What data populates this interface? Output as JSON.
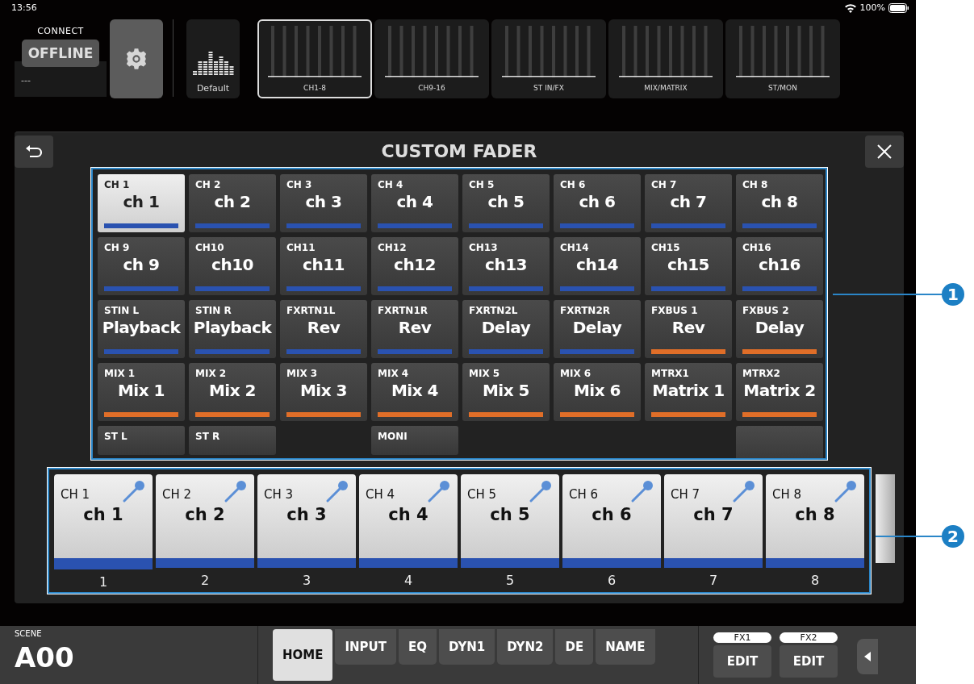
{
  "status_bar": {
    "time": "13:56",
    "battery": "100%"
  },
  "connect": {
    "label": "CONNECT",
    "status": "OFFLINE",
    "device": "---"
  },
  "library": {
    "label": "Default"
  },
  "bank_tabs": [
    {
      "label": "CH1-8",
      "selected": true
    },
    {
      "label": "CH9-16",
      "selected": false
    },
    {
      "label": "ST IN/FX",
      "selected": false
    },
    {
      "label": "MIX/MATRIX",
      "selected": false
    },
    {
      "label": "ST/MON",
      "selected": false
    }
  ],
  "dialog": {
    "title": "CUSTOM FADER"
  },
  "channel_grid": [
    {
      "kind": "full",
      "label": "CH 1",
      "name": "ch 1",
      "color": "#2a52b0",
      "selected": true
    },
    {
      "kind": "full",
      "label": "CH 2",
      "name": "ch 2",
      "color": "#2a52b0",
      "selected": false
    },
    {
      "kind": "full",
      "label": "CH 3",
      "name": "ch 3",
      "color": "#2a52b0",
      "selected": false
    },
    {
      "kind": "full",
      "label": "CH 4",
      "name": "ch 4",
      "color": "#2a52b0",
      "selected": false
    },
    {
      "kind": "full",
      "label": "CH 5",
      "name": "ch 5",
      "color": "#2a52b0",
      "selected": false
    },
    {
      "kind": "full",
      "label": "CH 6",
      "name": "ch 6",
      "color": "#2a52b0",
      "selected": false
    },
    {
      "kind": "full",
      "label": "CH 7",
      "name": "ch 7",
      "color": "#2a52b0",
      "selected": false
    },
    {
      "kind": "full",
      "label": "CH 8",
      "name": "ch 8",
      "color": "#2a52b0",
      "selected": false
    },
    {
      "kind": "full",
      "label": "CH 9",
      "name": "ch 9",
      "color": "#2a52b0",
      "selected": false
    },
    {
      "kind": "full",
      "label": "CH10",
      "name": "ch10",
      "color": "#2a52b0",
      "selected": false
    },
    {
      "kind": "full",
      "label": "CH11",
      "name": "ch11",
      "color": "#2a52b0",
      "selected": false
    },
    {
      "kind": "full",
      "label": "CH12",
      "name": "ch12",
      "color": "#2a52b0",
      "selected": false
    },
    {
      "kind": "full",
      "label": "CH13",
      "name": "ch13",
      "color": "#2a52b0",
      "selected": false
    },
    {
      "kind": "full",
      "label": "CH14",
      "name": "ch14",
      "color": "#2a52b0",
      "selected": false
    },
    {
      "kind": "full",
      "label": "CH15",
      "name": "ch15",
      "color": "#2a52b0",
      "selected": false
    },
    {
      "kind": "full",
      "label": "CH16",
      "name": "ch16",
      "color": "#2a52b0",
      "selected": false
    },
    {
      "kind": "full",
      "label": "STIN L",
      "name": "Playback",
      "color": "#2a52b0",
      "selected": false
    },
    {
      "kind": "full",
      "label": "STIN R",
      "name": "Playback",
      "color": "#2a52b0",
      "selected": false
    },
    {
      "kind": "full",
      "label": "FXRTN1L",
      "name": "Rev",
      "color": "#2a52b0",
      "selected": false
    },
    {
      "kind": "full",
      "label": "FXRTN1R",
      "name": "Rev",
      "color": "#2a52b0",
      "selected": false
    },
    {
      "kind": "full",
      "label": "FXRTN2L",
      "name": "Delay",
      "color": "#2a52b0",
      "selected": false
    },
    {
      "kind": "full",
      "label": "FXRTN2R",
      "name": "Delay",
      "color": "#2a52b0",
      "selected": false
    },
    {
      "kind": "full",
      "label": "FXBUS 1",
      "name": "Rev",
      "color": "#e06e28",
      "selected": false
    },
    {
      "kind": "full",
      "label": "FXBUS 2",
      "name": "Delay",
      "color": "#e06e28",
      "selected": false
    },
    {
      "kind": "full",
      "label": "MIX 1",
      "name": "Mix 1",
      "color": "#e06e28",
      "selected": false
    },
    {
      "kind": "full",
      "label": "MIX 2",
      "name": "Mix 2",
      "color": "#e06e28",
      "selected": false
    },
    {
      "kind": "full",
      "label": "MIX 3",
      "name": "Mix 3",
      "color": "#e06e28",
      "selected": false
    },
    {
      "kind": "full",
      "label": "MIX 4",
      "name": "Mix 4",
      "color": "#e06e28",
      "selected": false
    },
    {
      "kind": "full",
      "label": "MIX 5",
      "name": "Mix 5",
      "color": "#e06e28",
      "selected": false
    },
    {
      "kind": "full",
      "label": "MIX 6",
      "name": "Mix 6",
      "color": "#e06e28",
      "selected": false
    },
    {
      "kind": "full",
      "label": "MTRX1",
      "name": "Matrix 1",
      "color": "#e06e28",
      "selected": false
    },
    {
      "kind": "full",
      "label": "MTRX2",
      "name": "Matrix 2",
      "color": "#e06e28",
      "selected": false
    },
    {
      "kind": "partial",
      "label": "ST L"
    },
    {
      "kind": "partial",
      "label": "ST R"
    },
    {
      "kind": "empty"
    },
    {
      "kind": "partial",
      "label": "MONI"
    },
    {
      "kind": "empty"
    },
    {
      "kind": "empty"
    },
    {
      "kind": "empty"
    },
    {
      "kind": "blank"
    }
  ],
  "fader_strip": [
    {
      "label": "CH 1",
      "name": "ch 1",
      "number": "1",
      "selected": true
    },
    {
      "label": "CH 2",
      "name": "ch 2",
      "number": "2",
      "selected": false
    },
    {
      "label": "CH 3",
      "name": "ch 3",
      "number": "3",
      "selected": false
    },
    {
      "label": "CH 4",
      "name": "ch 4",
      "number": "4",
      "selected": false
    },
    {
      "label": "CH 5",
      "name": "ch 5",
      "number": "5",
      "selected": false
    },
    {
      "label": "CH 6",
      "name": "ch 6",
      "number": "6",
      "selected": false
    },
    {
      "label": "CH 7",
      "name": "ch 7",
      "number": "7",
      "selected": false
    },
    {
      "label": "CH 8",
      "name": "ch 8",
      "number": "8",
      "selected": false
    }
  ],
  "scene": {
    "label": "SCENE",
    "number": "A00"
  },
  "menu_tabs": [
    {
      "label": "HOME",
      "selected": true
    },
    {
      "label": "INPUT",
      "selected": false
    },
    {
      "label": "EQ",
      "selected": false
    },
    {
      "label": "DYN1",
      "selected": false
    },
    {
      "label": "DYN2",
      "selected": false
    },
    {
      "label": "DE",
      "selected": false
    },
    {
      "label": "NAME",
      "selected": false
    }
  ],
  "fx_buttons": [
    {
      "tag": "FX1",
      "label": "EDIT"
    },
    {
      "tag": "FX2",
      "label": "EDIT"
    }
  ],
  "callouts": [
    {
      "label": "1"
    },
    {
      "label": "2"
    }
  ]
}
